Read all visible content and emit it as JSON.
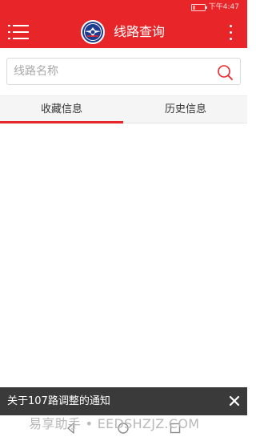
{
  "status_bar": {
    "time": "下午4:47",
    "battery_level": 0.2
  },
  "app_bar": {
    "title": "线路查询",
    "menu_icon": "hamburger-menu-icon",
    "more_icon": "more-vertical-icon",
    "logo_icon": "bus-company-logo"
  },
  "search": {
    "placeholder": "线路名称",
    "value": "",
    "icon": "search-icon"
  },
  "tabs": [
    {
      "label": "收藏信息",
      "active": true
    },
    {
      "label": "历史信息",
      "active": false
    }
  ],
  "notice": {
    "text": "关于107路调整的通知",
    "close_icon": "close-icon"
  },
  "nav_bar": {
    "back_icon": "back-icon",
    "home_icon": "home-icon",
    "recents_icon": "recents-icon"
  },
  "watermark": {
    "text": "易享助手 • EEDSHZJZ.COM"
  },
  "colors": {
    "primary": "#e8262a",
    "notice_bg": "#3a3a3a",
    "logo_blue": "#1f3c8f"
  }
}
